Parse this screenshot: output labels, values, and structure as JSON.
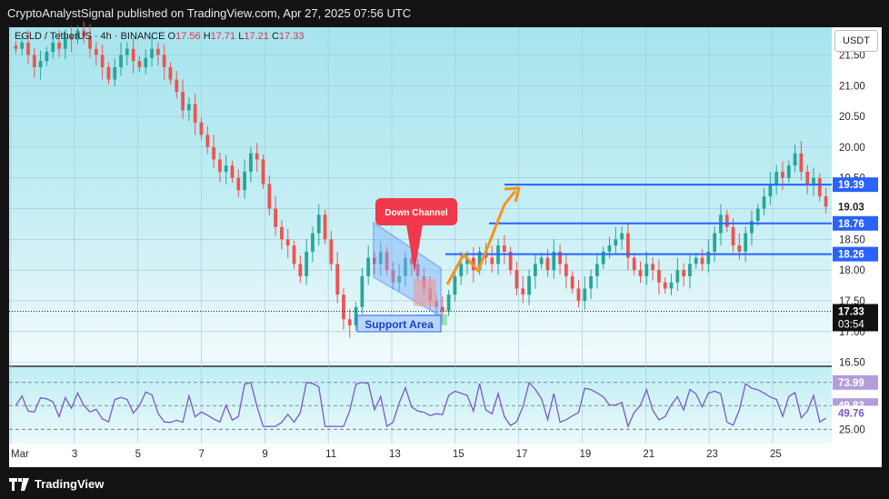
{
  "header": {
    "text": "CryptoAnalystSignal published on TradingView.com, Apr 27, 2025 07:56 UTC"
  },
  "symbol": {
    "name": "EGLD / TetherUS · 4h · BINANCE",
    "o_label": "O",
    "o": "17.56",
    "h_label": "H",
    "h": "17.71",
    "l_label": "L",
    "l": "17.21",
    "c_label": "C",
    "c": "17.33"
  },
  "currency_button": "USDT",
  "footer": {
    "brand": "TradingView"
  },
  "annotations": {
    "down_channel": "Down Channel",
    "support_area": "Support Area"
  },
  "price_tags": {
    "level_1": "19.39",
    "level_2": "18.76",
    "level_3": "18.26",
    "current_price": "17.33",
    "countdown": "03:54",
    "axis_19_03": "19.03"
  },
  "rsi_tags": {
    "top": "73.99",
    "mid": "49.83",
    "value": "49.76",
    "bottom": "25.00"
  },
  "colors": {
    "up": "#26a69a",
    "down": "#ef5350",
    "level_line": "#2962ff",
    "orange": "#f7931a",
    "annotation_red": "#f0394c",
    "rsi_line": "#7e57c2"
  },
  "chart_data": {
    "type": "candlestick",
    "symbol": "EGLD / TetherUS",
    "interval": "4h",
    "exchange": "BINANCE",
    "y_ticks": [
      16.5,
      17.0,
      17.5,
      18.0,
      18.5,
      19.0,
      19.5,
      20.0,
      20.5,
      21.0,
      21.5
    ],
    "ylim": [
      16.45,
      21.95
    ],
    "x_ticks": [
      "Mar",
      "3",
      "5",
      "7",
      "9",
      "11",
      "13",
      "15",
      "17",
      "19",
      "21",
      "23",
      "25"
    ],
    "horizontal_levels": [
      19.39,
      18.76,
      18.26
    ],
    "current_price": 17.33,
    "rsi": {
      "levels": [
        73.99,
        49.83,
        25.0
      ],
      "value": 49.76
    },
    "candles_close_approx": [
      21.6,
      21.7,
      21.5,
      21.3,
      21.4,
      21.55,
      21.7,
      21.6,
      21.8,
      21.75,
      21.9,
      21.8,
      21.6,
      21.5,
      21.3,
      21.1,
      21.3,
      21.5,
      21.6,
      21.4,
      21.3,
      21.45,
      21.6,
      21.5,
      21.3,
      21.1,
      20.9,
      20.6,
      20.7,
      20.4,
      20.2,
      20.0,
      19.8,
      19.6,
      19.7,
      19.5,
      19.3,
      19.6,
      19.9,
      19.8,
      19.4,
      19.0,
      18.7,
      18.5,
      18.4,
      18.1,
      17.9,
      18.3,
      18.6,
      18.9,
      18.5,
      18.1,
      17.6,
      17.2,
      17.1,
      17.4,
      17.9,
      18.2,
      18.1,
      18.3,
      18.0,
      17.8,
      17.9,
      18.2,
      18.1,
      17.9,
      17.7,
      17.5,
      17.4,
      17.33,
      17.6,
      17.9,
      18.1,
      18.2,
      18.0,
      18.3,
      18.2,
      18.1,
      18.4,
      18.3,
      18.0,
      17.7,
      17.6,
      17.9,
      18.1,
      18.2,
      18.0,
      18.3,
      18.1,
      17.9,
      17.7,
      17.5,
      17.7,
      17.9,
      18.1,
      18.3,
      18.4,
      18.5,
      18.6,
      18.2,
      18.0,
      17.9,
      18.1,
      18.0,
      17.8,
      17.7,
      17.8,
      18.0,
      17.9,
      18.1,
      18.2,
      18.1,
      18.3,
      18.6,
      18.9,
      18.7,
      18.4,
      18.3,
      18.6,
      18.8,
      19.0,
      19.2,
      19.4,
      19.6,
      19.5,
      19.7,
      19.9,
      19.6,
      19.4,
      19.5,
      19.2,
      19.03
    ]
  }
}
